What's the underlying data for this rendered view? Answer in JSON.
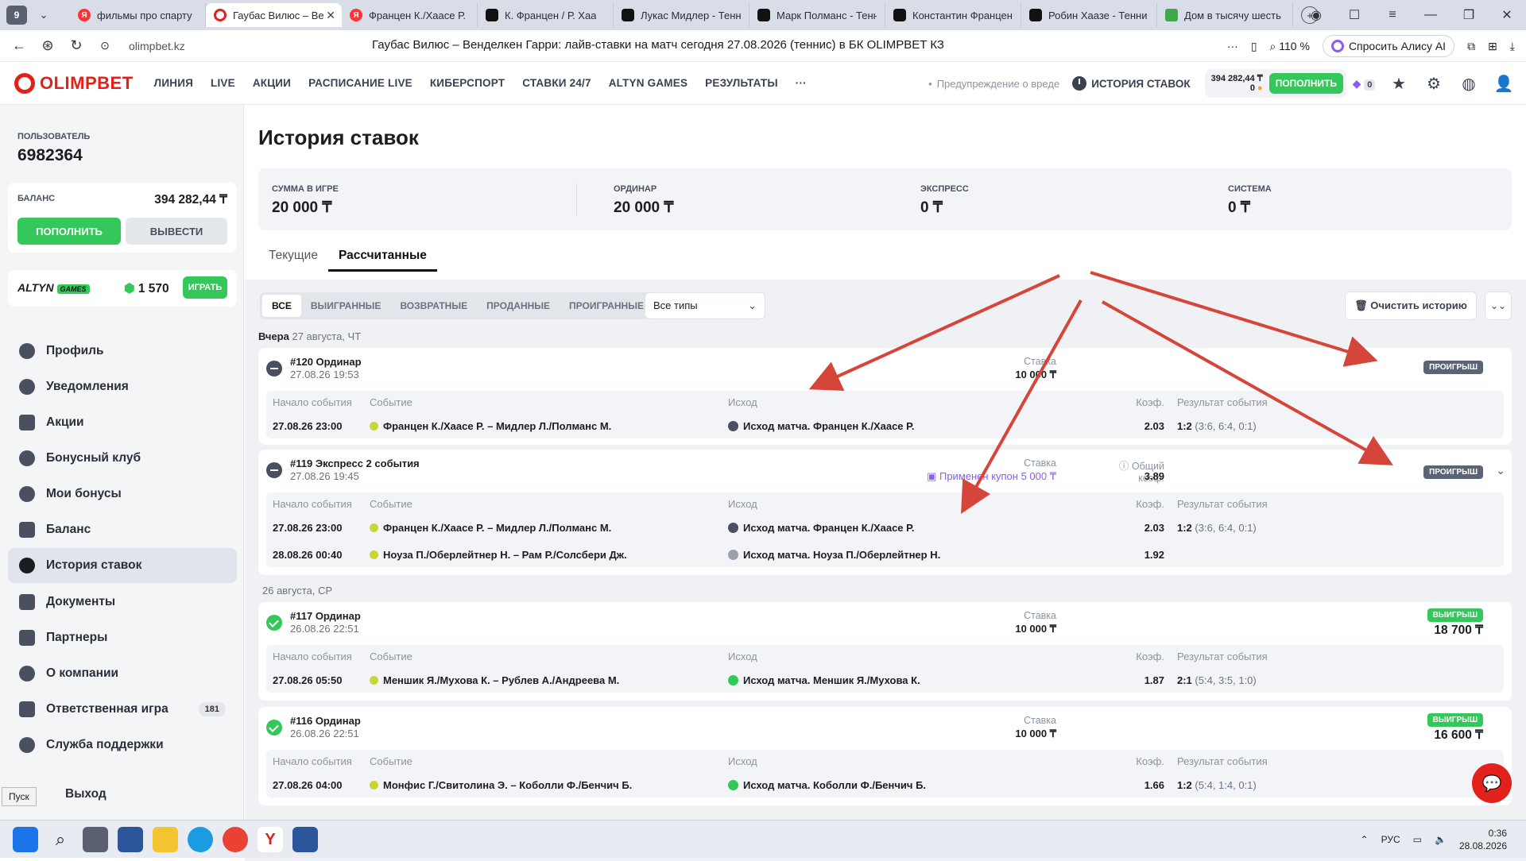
{
  "browser": {
    "tab_counter": "9",
    "tabs": [
      {
        "title": "фильмы про спарту",
        "icon": "yandex-icon"
      },
      {
        "title": "Гаубас Вилюс – Ве",
        "icon": "olimpbet-icon",
        "active": true
      },
      {
        "title": "Францен К./Хаасе Р.",
        "icon": "yandex-icon"
      },
      {
        "title": "К. Францен / Р. Хаа",
        "icon": "sofascore-icon"
      },
      {
        "title": "Лукас Мидлер - Тенн",
        "icon": "sofascore-icon"
      },
      {
        "title": "Марк Полманс - Тенн",
        "icon": "sofascore-icon"
      },
      {
        "title": "Константин Францен",
        "icon": "sofascore-icon"
      },
      {
        "title": "Робин Хаазе - Тенни",
        "icon": "sofascore-icon"
      },
      {
        "title": "Дом в тысячу шесть",
        "icon": "leaf-icon"
      }
    ],
    "url": "olimpbet.kz",
    "page_title": "Гаубас Вилюс – Венделкен Гарри: лайв-ставки на матч сегодня 27.08.2026 (теннис) в БК OLIMPBET КЗ",
    "zoom": "110 %",
    "alice": "Спросить Алису AI"
  },
  "site": {
    "logo": "OLIMPBET",
    "nav": [
      "ЛИНИЯ",
      "LIVE",
      "АКЦИИ",
      "РАСПИСАНИЕ LIVE",
      "КИБЕРСПОРТ",
      "СТАВКИ 24/7",
      "ALTYN GAMES",
      "РЕЗУЛЬТАТЫ",
      "···"
    ],
    "warning": "Предупреждение о вреде",
    "history": "ИСТОРИЯ СТАВОК",
    "balance": "394 282,44 ₸",
    "bonus": "0",
    "topup": "ПОПОЛНИТЬ",
    "notif_count": "0"
  },
  "sidebar": {
    "user_label": "ПОЛЬЗОВАТЕЛЬ",
    "user_id": "6982364",
    "balance_label": "БАЛАНС",
    "balance_value": "394 282,44 ₸",
    "topup": "ПОПОЛНИТЬ",
    "withdraw": "ВЫВЕСТИ",
    "altyn_logo": "ALTYN",
    "altyn_games": "GAMES",
    "altyn_value": "1 570",
    "play": "ИГРАТЬ",
    "menu": [
      {
        "label": "Профиль",
        "icon": "user-icon"
      },
      {
        "label": "Уведомления",
        "icon": "bell-icon"
      },
      {
        "label": "Акции",
        "icon": "gift-icon"
      },
      {
        "label": "Бонусный клуб",
        "icon": "club-icon"
      },
      {
        "label": "Мои бонусы",
        "icon": "star-icon"
      },
      {
        "label": "Баланс",
        "icon": "wallet-icon"
      },
      {
        "label": "История ставок",
        "icon": "clock-icon",
        "active": true
      },
      {
        "label": "Документы",
        "icon": "document-icon"
      },
      {
        "label": "Партнеры",
        "icon": "handshake-icon"
      },
      {
        "label": "О компании",
        "icon": "info-icon"
      },
      {
        "label": "Ответственная игра",
        "icon": "lock-icon",
        "badge": "181"
      },
      {
        "label": "Служба поддержки",
        "icon": "support-icon"
      }
    ],
    "logout": "Выход",
    "tooltip": "Пуск"
  },
  "main": {
    "title": "История ставок",
    "stats": [
      {
        "label": "СУММА В ИГРЕ",
        "value": "20 000 ₸"
      },
      {
        "label": "ОРДИНАР",
        "value": "20 000 ₸"
      },
      {
        "label": "ЭКСПРЕСС",
        "value": "0 ₸"
      },
      {
        "label": "СИСТЕМА",
        "value": "0 ₸"
      }
    ],
    "tabs": [
      "Текущие",
      "Рассчитанные"
    ],
    "filters": [
      "ВСЕ",
      "ВЫИГРАННЫЕ",
      "ВОЗВРАТНЫЕ",
      "ПРОДАННЫЕ",
      "ПРОИГРАННЫЕ"
    ],
    "type_select": "Все типы",
    "clear_history": "Очистить историю",
    "col_headers": {
      "start": "Начало события",
      "event": "Событие",
      "outcome": "Исход",
      "odds": "Коэф.",
      "result": "Результат события"
    },
    "stake_label": "Ставка",
    "total_odds_label": "Общий коэф.",
    "days": [
      {
        "name": "Вчера",
        "date": "27 августа, ЧТ"
      },
      {
        "name": "",
        "date": "26 августа, СР"
      }
    ],
    "bets": [
      {
        "title": "#120 Ординар",
        "date": "27.08.26 19:53",
        "stake": "10 000 ₸",
        "status": "ПРОИГРЫШ",
        "events": [
          {
            "start": "27.08.26 23:00",
            "event": "Францен К./Хаасе Р. – Мидлер Л./Полманс М.",
            "outcome": "Исход матча. Францен К./Хаасе Р.",
            "odds": "2.03",
            "result": "1:2",
            "detail": "(3:6, 6:4, 0:1)"
          }
        ]
      },
      {
        "title": "#119 Экспресс 2 события",
        "date": "27.08.26 19:45",
        "stake": "Применен купон 5 000 ₸",
        "total_odds": "3.89",
        "status": "ПРОИГРЫШ",
        "events": [
          {
            "start": "27.08.26 23:00",
            "event": "Францен К./Хаасе Р. – Мидлер Л./Полманс М.",
            "outcome": "Исход матча. Францен К./Хаасе Р.",
            "odds": "2.03",
            "result": "1:2",
            "detail": "(3:6, 6:4, 0:1)"
          },
          {
            "start": "28.08.26 00:40",
            "event": "Ноуза П./Оберлейтнер Н. – Рам Р./Солсбери Дж.",
            "outcome": "Исход матча. Ноуза П./Оберлейтнер Н.",
            "odds": "1.92",
            "result": "",
            "detail": ""
          }
        ]
      },
      {
        "title": "#117 Ординар",
        "date": "26.08.26 22:51",
        "stake": "10 000 ₸",
        "status": "ВЫИГРЫШ",
        "payout": "18 700 ₸",
        "events": [
          {
            "start": "27.08.26 05:50",
            "event": "Меншик Я./Мухова К. – Рублев А./Андреева М.",
            "outcome": "Исход матча. Меншик Я./Мухова К.",
            "odds": "1.87",
            "result": "2:1",
            "detail": "(5:4, 3:5, 1:0)"
          }
        ]
      },
      {
        "title": "#116 Ординар",
        "date": "26.08.26 22:51",
        "stake": "10 000 ₸",
        "status": "ВЫИГРЫШ",
        "payout": "16 600 ₸",
        "events": [
          {
            "start": "27.08.26 04:00",
            "event": "Монфис Г./Свитолина Э. – Коболли Ф./Бенчич Б.",
            "outcome": "Исход матча. Коболли Ф./Бенчич Б.",
            "odds": "1.66",
            "result": "1:2",
            "detail": "(5:4, 1:4, 0:1)"
          }
        ]
      }
    ]
  },
  "taskbar": {
    "lang": "РУС",
    "time": "0:36",
    "date": "28.08.2026"
  },
  "colors": {
    "brand": "#e3211b",
    "win": "#34c759",
    "loss": "#5b6475",
    "annotation_arrow": "#d6453a"
  }
}
